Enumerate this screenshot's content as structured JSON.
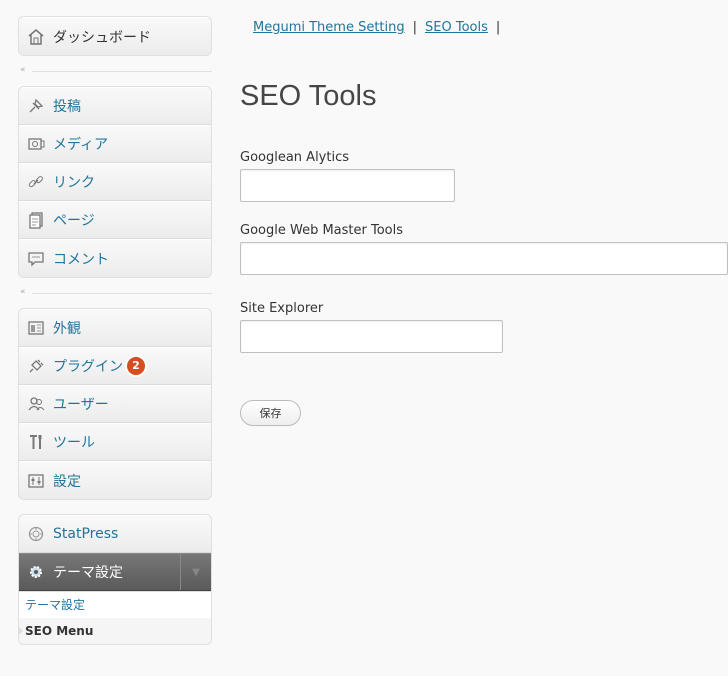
{
  "sidebar": {
    "dashboard": "ダッシュボード",
    "group2": [
      {
        "label": "投稿",
        "icon": "pushpin-icon"
      },
      {
        "label": "メディア",
        "icon": "media-icon"
      },
      {
        "label": "リンク",
        "icon": "link-icon"
      },
      {
        "label": "ページ",
        "icon": "page-icon"
      },
      {
        "label": "コメント",
        "icon": "comment-icon"
      }
    ],
    "group3": [
      {
        "label": "外観",
        "icon": "appearance-icon"
      },
      {
        "label": "プラグイン",
        "icon": "plugin-icon",
        "badge": "2"
      },
      {
        "label": "ユーザー",
        "icon": "users-icon"
      },
      {
        "label": "ツール",
        "icon": "tools-icon"
      },
      {
        "label": "設定",
        "icon": "settings-icon"
      }
    ],
    "statpress": "StatPress",
    "theme_settings": "テーマ設定",
    "submenu": [
      "テーマ設定",
      "SEO Menu"
    ]
  },
  "tabs": [
    "Megumi Theme Setting",
    "SEO Tools"
  ],
  "page_title": "SEO Tools",
  "fields": [
    {
      "label": "Googlean Alytics",
      "value": ""
    },
    {
      "label": "Google Web Master Tools",
      "value": ""
    },
    {
      "label": "Site Explorer",
      "value": ""
    }
  ],
  "save_label": "保存",
  "colors": {
    "link": "#21759b",
    "badge": "#d54e21",
    "current_bg": "#5a5a5a"
  }
}
